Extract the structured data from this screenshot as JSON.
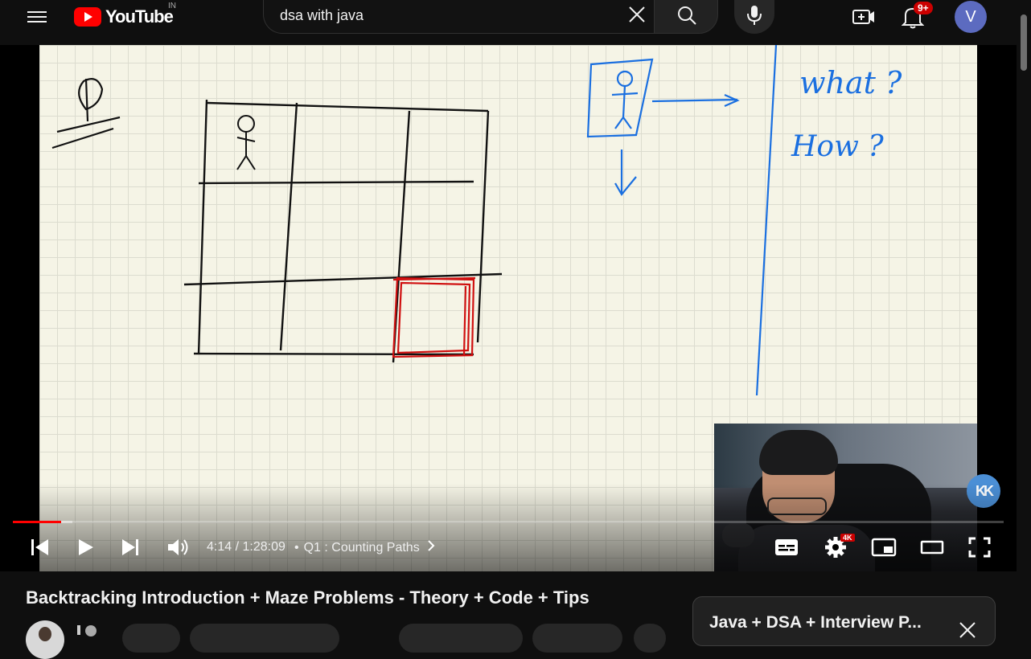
{
  "header": {
    "logo_text": "YouTube",
    "region": "IN",
    "search_value": "dsa with java",
    "notification_count": "9+",
    "avatar_letter": "V"
  },
  "player": {
    "time": "4:14 / 1:28:09",
    "chapter": "Q1 : Counting Paths",
    "quality_badge": "4K",
    "progress_fraction": 0.049,
    "buffer_fraction": 0.06,
    "whiteboard_text": {
      "what": "what ?",
      "how": "How ?"
    },
    "channel_watermark": "KK"
  },
  "video": {
    "title": "Backtracking Introduction + Maze Problems - Theory + Code + Tips"
  },
  "playlist": {
    "title": "Java + DSA + Interview P..."
  },
  "colors": {
    "accent": "#ff0000",
    "pen_black": "#111111",
    "pen_red": "#d01010",
    "pen_blue": "#1a6fe0",
    "whiteboard": "#f5f4e6"
  }
}
